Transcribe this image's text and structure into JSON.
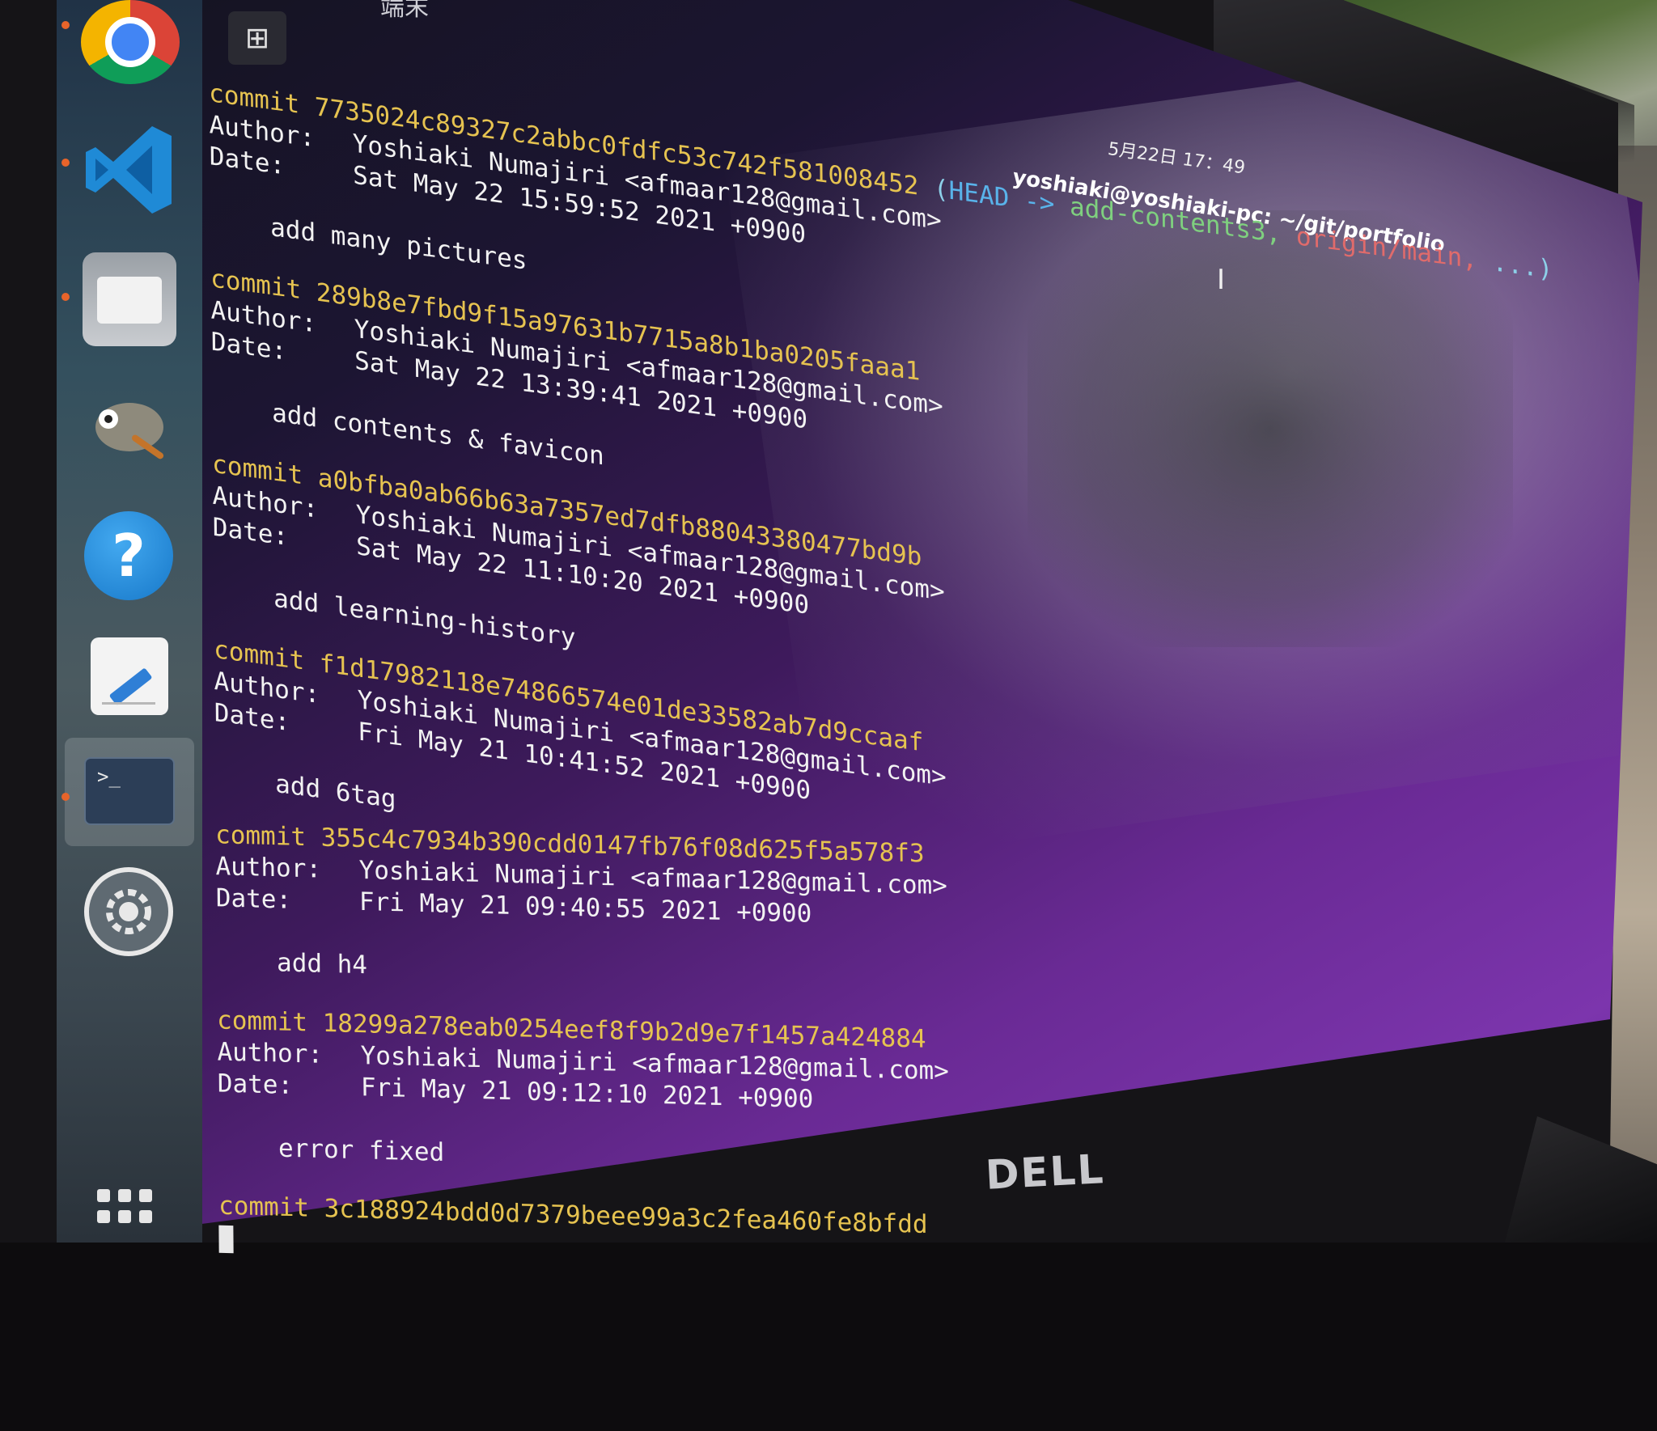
{
  "top_fragment": "端末",
  "clock": "5月22日  17：49",
  "window_title": "yoshiaki@yoshiaki-pc: ~/git/portfolio",
  "brand": "DELL",
  "dock": {
    "apps": [
      "chrome-icon",
      "vscode-icon",
      "files-icon",
      "gimp-icon",
      "help-icon",
      "text-editor-icon",
      "terminal-icon",
      "settings-icon",
      "show-apps-icon"
    ],
    "help_glyph": "?",
    "terminal_glyph": ">_"
  },
  "terminal": {
    "new_tab_glyph": "⊞",
    "labels": {
      "commit": "commit",
      "author": "Author:",
      "date": "Date:"
    },
    "head_refs": {
      "open": "(",
      "head": "HEAD ->",
      "branch": "add-contents3,",
      "remote": "origin/main,",
      "rest": "...)"
    },
    "commits": [
      {
        "hash": "7735024c89327c2abbc0fdfc53c742f581008452",
        "author": "Yoshiaki Numajiri <afmaar128@gmail.com>",
        "date": "Sat May 22 15:59:52 2021 +0900",
        "message": "add many pictures"
      },
      {
        "hash": "289b8e7fbd9f15a97631b7715a8b1ba0205faaa1",
        "author": "Yoshiaki Numajiri <afmaar128@gmail.com>",
        "date": "Sat May 22 13:39:41 2021 +0900",
        "message": "add contents & favicon"
      },
      {
        "hash": "a0bfba0ab66b63a7357ed7dfb88043380477bd9b",
        "author": "Yoshiaki Numajiri <afmaar128@gmail.com>",
        "date": "Sat May 22 11:10:20 2021 +0900",
        "message": "add learning-history"
      },
      {
        "hash": "f1d17982118e74866574e01de33582ab7d9ccaaf",
        "author": "Yoshiaki Numajiri <afmaar128@gmail.com>",
        "date": "Fri May 21 10:41:52 2021 +0900",
        "message": "add 6tag"
      },
      {
        "hash": "355c4c7934b390cdd0147fb76f08d625f5a578f3",
        "author": "Yoshiaki Numajiri <afmaar128@gmail.com>",
        "date": "Fri May 21 09:40:55 2021 +0900",
        "message": "add h4"
      },
      {
        "hash": "18299a278eab0254eef8f9b2d9e7f1457a424884",
        "author": "Yoshiaki Numajiri <afmaar128@gmail.com>",
        "date": "Fri May 21 09:12:10 2021 +0900",
        "message": "error fixed"
      },
      {
        "hash": "3c188924bdd0d7379beee99a3c2fea460fe8bfdd"
      }
    ]
  }
}
